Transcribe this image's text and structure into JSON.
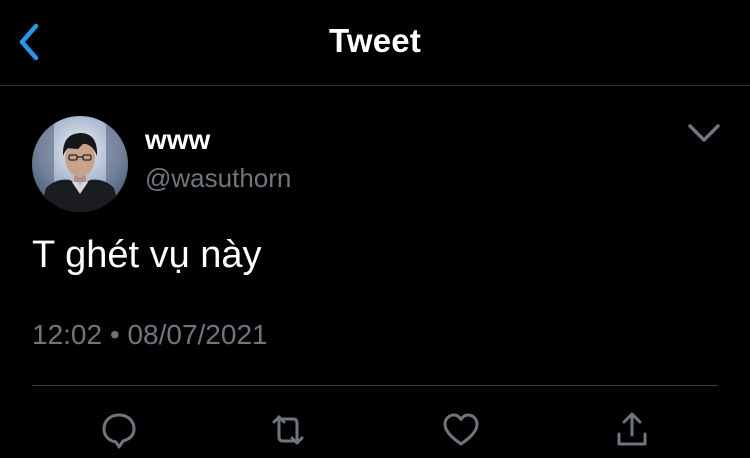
{
  "header": {
    "title": "Tweet",
    "back_icon": "chevron-left-icon"
  },
  "tweet": {
    "author": {
      "display_name": "www",
      "handle": "@wasuthorn",
      "avatar_icon": "avatar-photo"
    },
    "text": "T ghét vụ này",
    "time": "12:02",
    "separator": "•",
    "date": "08/07/2021",
    "options_icon": "chevron-down-icon"
  },
  "actions": [
    {
      "name": "reply",
      "icon": "comment-icon"
    },
    {
      "name": "retweet",
      "icon": "retweet-icon"
    },
    {
      "name": "like",
      "icon": "heart-icon"
    },
    {
      "name": "share",
      "icon": "share-icon"
    }
  ],
  "colors": {
    "background": "#000000",
    "accent": "#1d9bf0",
    "secondary_text": "#6e767d",
    "icon": "#6e767d",
    "divider": "#3d4145"
  }
}
